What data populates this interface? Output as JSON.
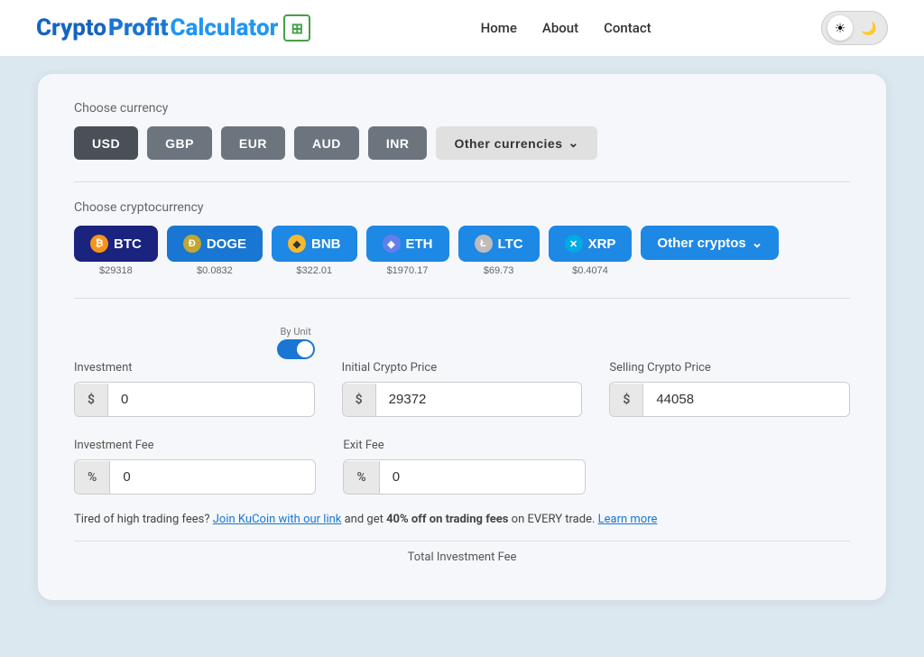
{
  "logo": {
    "crypto": "Crypto",
    "profit": "Profit",
    "calculator": "Calculator",
    "icon": "⊞"
  },
  "nav": {
    "home": "Home",
    "about": "About",
    "contact": "Contact"
  },
  "theme": {
    "light_icon": "☀",
    "dark_icon": "🌙"
  },
  "currency_section": {
    "label": "Choose currency",
    "buttons": [
      {
        "id": "usd",
        "label": "USD",
        "active": true
      },
      {
        "id": "gbp",
        "label": "GBP",
        "active": false
      },
      {
        "id": "eur",
        "label": "EUR",
        "active": false
      },
      {
        "id": "aud",
        "label": "AUD",
        "active": false
      },
      {
        "id": "inr",
        "label": "INR",
        "active": false
      },
      {
        "id": "other",
        "label": "Other currencies",
        "active": false,
        "other": true
      }
    ]
  },
  "crypto_section": {
    "label": "Choose cryptocurrency",
    "cryptos": [
      {
        "id": "btc",
        "label": "BTC",
        "price": "$29318",
        "icon": "₿",
        "icon_class": "icon-btc",
        "inner_class": "btc"
      },
      {
        "id": "doge",
        "label": "DOGE",
        "price": "$0.0832",
        "icon": "Ð",
        "icon_class": "icon-doge",
        "inner_class": "doge"
      },
      {
        "id": "bnb",
        "label": "BNB",
        "price": "$322.01",
        "icon": "◆",
        "icon_class": "icon-bnb",
        "inner_class": "bnb"
      },
      {
        "id": "eth",
        "label": "ETH",
        "price": "$1970.17",
        "icon": "◈",
        "icon_class": "icon-eth",
        "inner_class": "eth"
      },
      {
        "id": "ltc",
        "label": "LTC",
        "price": "$69.73",
        "icon": "Ł",
        "icon_class": "icon-ltc",
        "inner_class": "ltc"
      },
      {
        "id": "xrp",
        "label": "XRP",
        "price": "$0.4074",
        "icon": "✕",
        "icon_class": "icon-xrp",
        "inner_class": "xrp"
      }
    ],
    "other_label": "Other cryptos"
  },
  "form": {
    "by_unit_label": "By Unit",
    "investment_label": "Investment",
    "investment_prefix": "$",
    "investment_value": "0",
    "initial_price_label": "Initial Crypto Price",
    "initial_price_prefix": "$",
    "initial_price_value": "29372",
    "selling_price_label": "Selling Crypto Price",
    "selling_price_prefix": "$",
    "selling_price_value": "44058",
    "inv_fee_label": "Investment Fee",
    "inv_fee_prefix": "%",
    "inv_fee_value": "0",
    "exit_fee_label": "Exit Fee",
    "exit_fee_prefix": "%",
    "exit_fee_value": "0"
  },
  "promo": {
    "text1": "Tired of high trading fees?",
    "link1": "Join KuCoin with our link",
    "text2": "and get",
    "bold": "40% off on trading fees",
    "text3": "on EVERY trade.",
    "link2": "Learn more"
  },
  "total": {
    "label": "Total Investment Fee"
  }
}
